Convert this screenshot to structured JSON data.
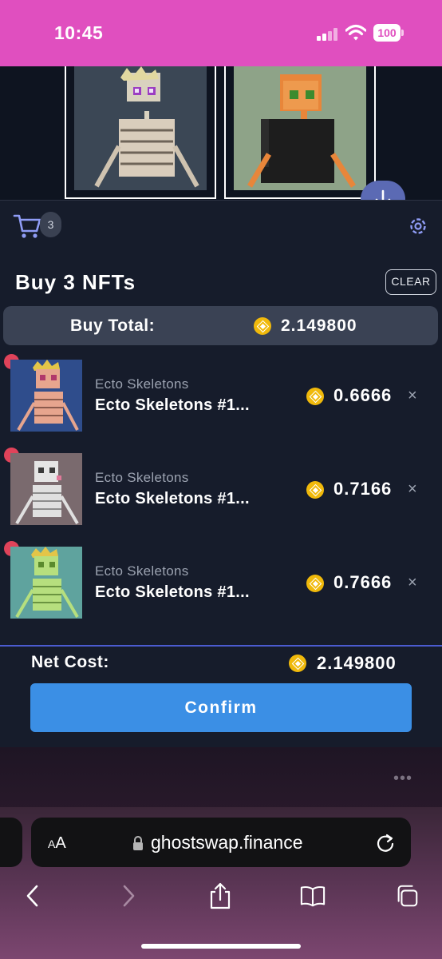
{
  "status_bar": {
    "time": "10:45",
    "battery": "100"
  },
  "cart": {
    "count": "3",
    "title": "Buy 3 NFTs",
    "clear_label": "CLEAR"
  },
  "totals": {
    "buy_total_label": "Buy Total:",
    "buy_total_value": "2.149800",
    "net_cost_label": "Net Cost:",
    "net_cost_value": "2.149800"
  },
  "items": [
    {
      "collection": "Ecto Skeletons",
      "name": "Ecto Skeletons #1...",
      "price": "0.6666",
      "remove": "×"
    },
    {
      "collection": "Ecto Skeletons",
      "name": "Ecto Skeletons #1...",
      "price": "0.7166",
      "remove": "×"
    },
    {
      "collection": "Ecto Skeletons",
      "name": "Ecto Skeletons #1...",
      "price": "0.7666",
      "remove": "×"
    }
  ],
  "confirm_label": "Confirm",
  "browser": {
    "aa_small": "A",
    "aa_large": "A",
    "url": "ghostswap.finance",
    "more": "•••"
  },
  "colors": {
    "status_bar": "#e04fbf",
    "panel": "#161c2b",
    "confirm": "#3b8fe5",
    "coin": "#f0b90b",
    "remove_badge": "#e0435a"
  },
  "icons": [
    "cart-icon",
    "gear-icon",
    "arrow-down-icon",
    "coin-icon",
    "lock-icon",
    "reload-icon",
    "back-icon",
    "forward-icon",
    "share-icon",
    "bookmarks-icon",
    "tabs-icon"
  ]
}
